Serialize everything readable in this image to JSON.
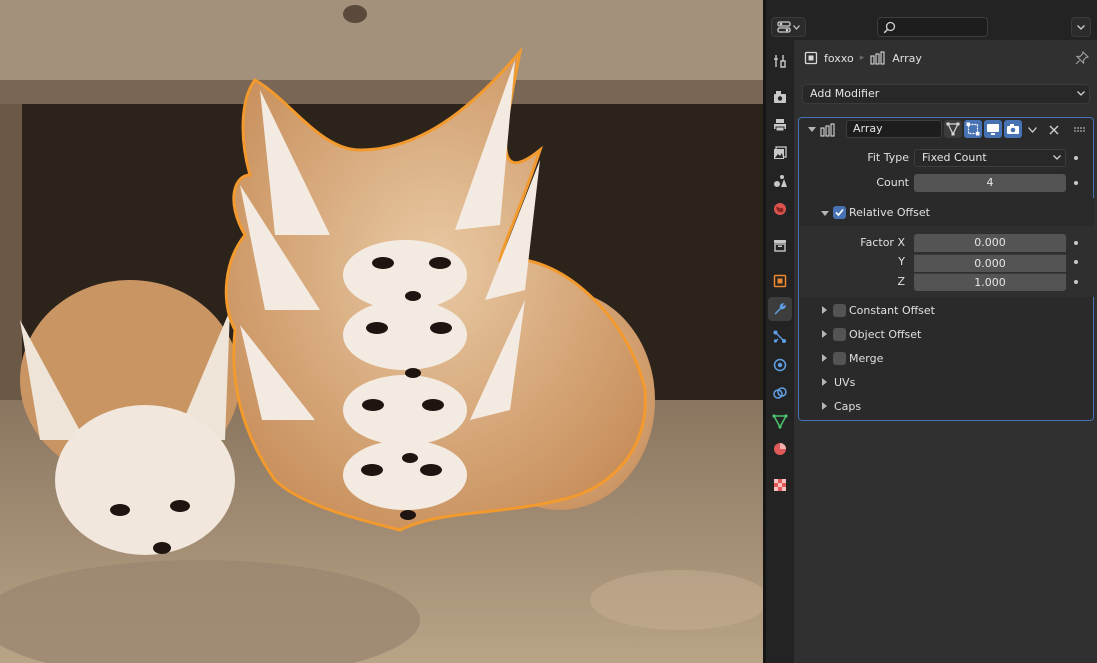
{
  "viewport": {
    "description_icon": "foxes-photo",
    "outline_color": "#f29a2e"
  },
  "header": {
    "editor_type_icon": "editor-type-icon",
    "search_placeholder": ""
  },
  "tabs": [
    {
      "name": "tool",
      "icon": "wrench-screwdriver-icon",
      "color": "#c8c8c8"
    },
    {
      "name": "render",
      "icon": "camera-back-icon",
      "color": "#c8c8c8"
    },
    {
      "name": "output",
      "icon": "printer-icon",
      "color": "#c8c8c8"
    },
    {
      "name": "view-layer",
      "icon": "image-icon",
      "color": "#c8c8c8"
    },
    {
      "name": "scene",
      "icon": "scene-icon",
      "color": "#c8c8c8"
    },
    {
      "name": "world",
      "icon": "world-icon",
      "color": "#d9534f"
    },
    {
      "name": "collection",
      "icon": "box-icon",
      "color": "#c8c8c8"
    },
    {
      "name": "object",
      "icon": "object-icon",
      "color": "#f0862d"
    },
    {
      "name": "modifiers",
      "icon": "wrench-icon",
      "color": "#5fa0e8",
      "active": true
    },
    {
      "name": "particles",
      "icon": "particles-icon",
      "color": "#5fa0e8"
    },
    {
      "name": "physics",
      "icon": "physics-icon",
      "color": "#5fa0e8"
    },
    {
      "name": "constraints",
      "icon": "constraint-icon",
      "color": "#5fa0e8"
    },
    {
      "name": "data",
      "icon": "mesh-data-icon",
      "color": "#4bc36d"
    },
    {
      "name": "material",
      "icon": "material-icon",
      "color": "#e05a5a"
    },
    {
      "name": "texture",
      "icon": "texture-icon",
      "color": "#e05a5a"
    }
  ],
  "breadcrumb": {
    "object": "foxxo",
    "modifier": "Array"
  },
  "add_modifier": "Add Modifier",
  "modifier": {
    "name": "Array",
    "fit_type_label": "Fit Type",
    "fit_type_value": "Fixed Count",
    "count_label": "Count",
    "count_value": "4",
    "relative_offset_label": "Relative Offset",
    "relative_offset_checked": true,
    "factor_x_label": "Factor X",
    "factor_x": "0.000",
    "y_label": "Y",
    "factor_y": "0.000",
    "z_label": "Z",
    "factor_z": "1.000",
    "constant_offset_label": "Constant Offset",
    "object_offset_label": "Object Offset",
    "merge_label": "Merge",
    "uvs_label": "UVs",
    "caps_label": "Caps"
  },
  "colors": {
    "accent": "#4772b3",
    "panel": "#303030",
    "field": "#545454"
  }
}
